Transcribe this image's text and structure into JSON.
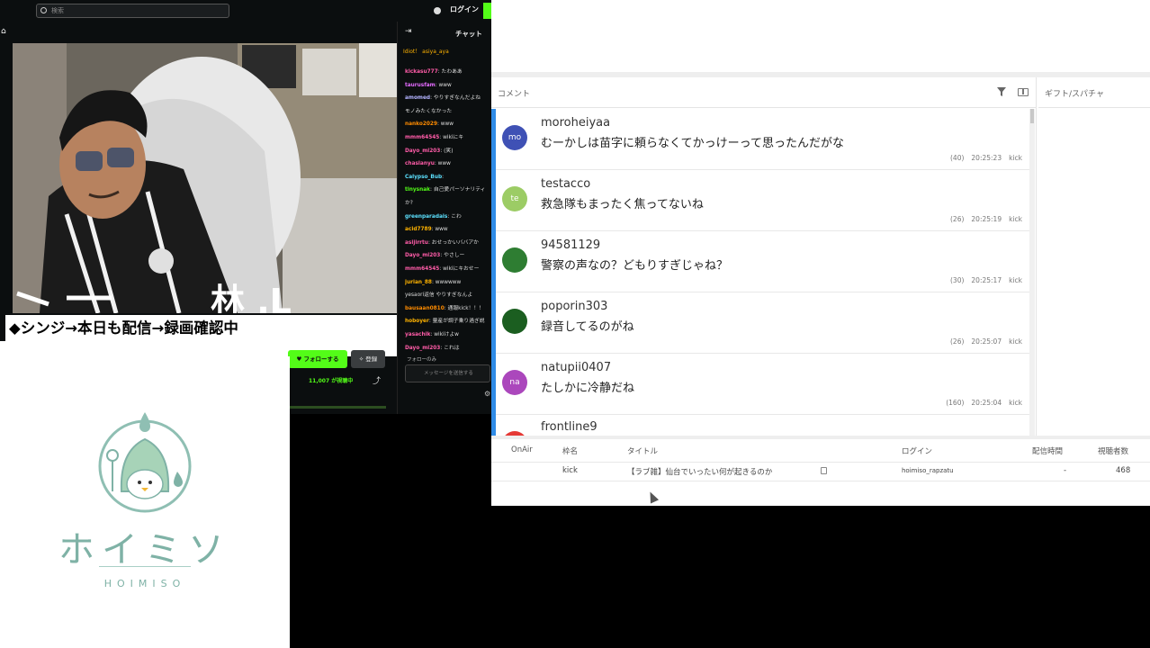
{
  "stream": {
    "search_placeholder": "検索",
    "login": "ログイン",
    "caption": "◆シンジ→本日も配信→録画確認中",
    "follow_button": "フォローする",
    "subscribe_button": "登録",
    "viewer_count": "11,007 が視聴中",
    "chat": {
      "title": "チャット",
      "pinned": "Idiot！  asiya_aya",
      "messages": [
        {
          "user": "kickasu777",
          "text": "たわああ",
          "color": "#ff5ca8"
        },
        {
          "user": "taurusfam",
          "text": "www",
          "color": "#e56cff"
        },
        {
          "user": "amomed",
          "text": "やりすぎなんだよね",
          "color": "#b3b3ff"
        },
        {
          "user": "",
          "text": "モノみたくなかった",
          "color": "#ddd"
        },
        {
          "user": "nanko2029",
          "text": "www",
          "color": "#ff8c00"
        },
        {
          "user": "mmm64545",
          "text": "wikiにキ",
          "color": "#ff5ca8"
        },
        {
          "user": "Dayo_mi203",
          "text": "(笑)",
          "color": "#ff5ca8"
        },
        {
          "user": "chaslanyu",
          "text": "www",
          "color": "#ff5ca8"
        },
        {
          "user": "Calypso_Bub",
          "text": "",
          "color": "#5ce1ff"
        },
        {
          "user": "tinysnak",
          "text": "自己愛パーソナリティ",
          "color": "#53fc18"
        },
        {
          "user": "",
          "text": "か?",
          "color": "#ddd"
        },
        {
          "user": "greenparadais",
          "text": "こわ",
          "color": "#5ce1ff"
        },
        {
          "user": "acid7789",
          "text": "www",
          "color": "#ffb300"
        },
        {
          "user": "asijirrtu",
          "text": "おせっかいババアか",
          "color": "#ff5ca8"
        },
        {
          "user": "Dayo_mi203",
          "text": "やさしー",
          "color": "#ff5ca8"
        },
        {
          "user": "mmm64545",
          "text": "wikiにキおせー",
          "color": "#ff5ca8"
        },
        {
          "user": "jurian_88",
          "text": "wwwwww",
          "color": "#ffb300"
        },
        {
          "user": "",
          "text": "yesaori返信 やりすぎなんよ",
          "color": "#999"
        },
        {
          "user": "bausaan0810",
          "text": "通報kick！！！",
          "color": "#ff8c00"
        },
        {
          "user": "hoboyer",
          "text": "量産が調子乗り過ぎ説",
          "color": "#ffb300"
        },
        {
          "user": "yasachik",
          "text": "wikiけよw",
          "color": "#ff5ca8"
        },
        {
          "user": "Dayo_mi203",
          "text": "これは",
          "color": "#ff5ca8"
        }
      ],
      "follow_note": "フォローのみ",
      "input_placeholder": "メッセージを送信する"
    }
  },
  "logo": {
    "name": "ホイミソ",
    "sub": "HOIMISO"
  },
  "comment_viewer": {
    "comments_title": "コメント",
    "gifts_title": "ギフト/スパチャ",
    "comments": [
      {
        "initials": "mo",
        "name": "moroheiyaa",
        "text": "むーかしは苗字に頼らなくてかっけーって思ったんだがな",
        "count": "(40)",
        "time": "20:25:23",
        "platform": "kick",
        "avatar_color": "#3f51b5"
      },
      {
        "initials": "te",
        "name": "testacco",
        "text": "救急隊もまったく焦ってないね",
        "count": "(26)",
        "time": "20:25:19",
        "platform": "kick",
        "avatar_color": "#9ccc65"
      },
      {
        "initials": "",
        "name": "94581129",
        "text": "警察の声なの？どもりすぎじゃね？",
        "count": "(30)",
        "time": "20:25:17",
        "platform": "kick",
        "avatar_color": "#2e7d32"
      },
      {
        "initials": "",
        "name": "poporin303",
        "text": "録音してるのがね",
        "count": "(26)",
        "time": "20:25:07",
        "platform": "kick",
        "avatar_color": "#1b5e20"
      },
      {
        "initials": "na",
        "name": "natupii0407",
        "text": "たしかに冷静だね",
        "count": "(160)",
        "time": "20:25:04",
        "platform": "kick",
        "avatar_color": "#ab47bc"
      },
      {
        "initials": "",
        "name": "frontline9",
        "text": "",
        "count": "",
        "time": "",
        "platform": "",
        "avatar_color": "#e53935"
      }
    ],
    "table": {
      "headers": [
        "OnAir",
        "枠名",
        "タイトル",
        "ログイン",
        "配信時間",
        "視聴者数"
      ],
      "row": {
        "onair": "",
        "site": "kick",
        "title": "【ラブ雑】仙台でいったい何が起きるのか",
        "login": "hoimiso_rapzatu",
        "duration": "-",
        "viewers": "468"
      }
    }
  }
}
